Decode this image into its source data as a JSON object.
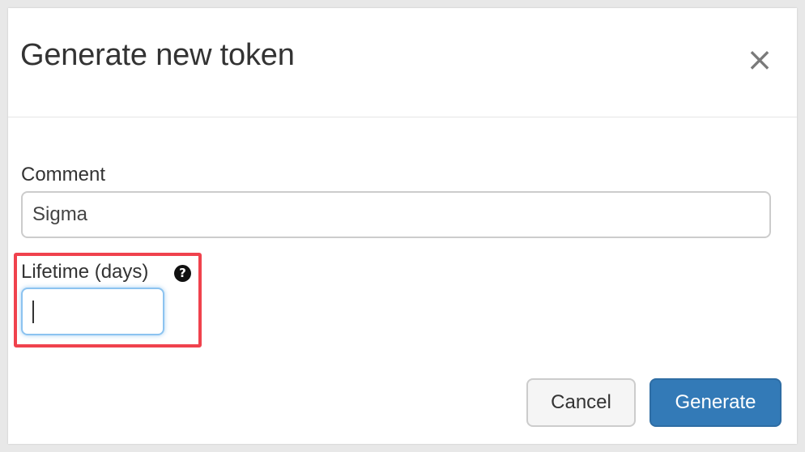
{
  "dialog": {
    "title": "Generate new token",
    "close_symbol": "×"
  },
  "form": {
    "comment": {
      "label": "Comment",
      "value": "Sigma"
    },
    "lifetime": {
      "label": "Lifetime (days)",
      "value": "",
      "help_symbol": "?",
      "highlight_color": "#f0424d"
    }
  },
  "footer": {
    "cancel_label": "Cancel",
    "generate_label": "Generate",
    "primary_color": "#337ab7"
  },
  "icons": {
    "close": "close-icon",
    "help": "question-circle-icon"
  }
}
